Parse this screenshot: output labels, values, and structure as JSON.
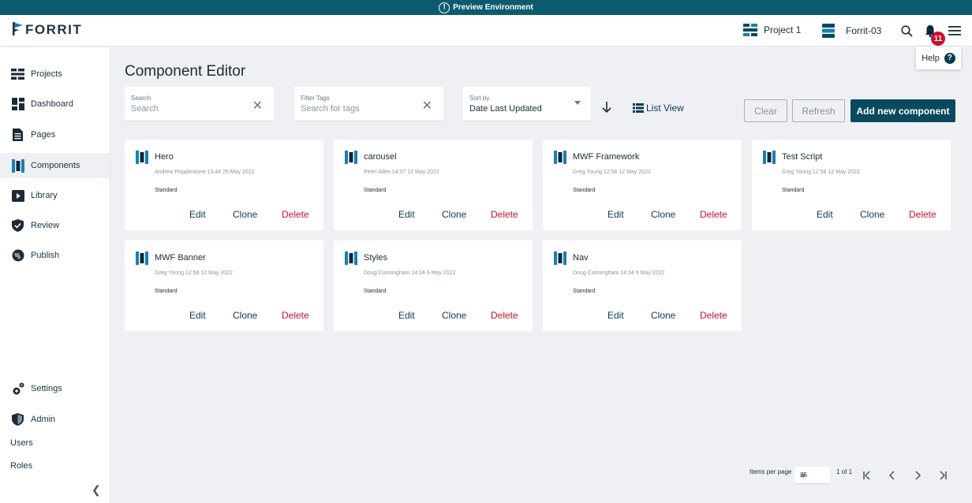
{
  "preview": {
    "label": "Preview Environment"
  },
  "brand": {
    "name": "FORRIT"
  },
  "topbar": {
    "project": "Project 1",
    "environment": "Forrit-03",
    "notifications_count": "11",
    "help_label": "Help"
  },
  "sidebar": {
    "items": [
      {
        "label": "Projects",
        "icon": "projects-icon"
      },
      {
        "label": "Dashboard",
        "icon": "dashboard-icon"
      },
      {
        "label": "Pages",
        "icon": "pages-icon"
      },
      {
        "label": "Components",
        "icon": "components-icon",
        "active": true
      },
      {
        "label": "Library",
        "icon": "library-icon"
      },
      {
        "label": "Review",
        "icon": "review-icon"
      },
      {
        "label": "Publish",
        "icon": "publish-icon"
      }
    ],
    "bottom": [
      {
        "label": "Settings",
        "icon": "gear-icon"
      },
      {
        "label": "Admin",
        "icon": "admin-shield-icon"
      }
    ],
    "sub_links": [
      "Users",
      "Roles"
    ]
  },
  "main": {
    "title": "Component Editor",
    "search": {
      "label": "Search",
      "placeholder": "Search"
    },
    "filter": {
      "label": "Filter Tags",
      "placeholder": "Search for tags"
    },
    "sort": {
      "label": "Sort by",
      "value": "Date Last Updated"
    },
    "list_view_label": "List View",
    "buttons": {
      "clear": "Clear",
      "refresh": "Refresh",
      "add": "Add new component"
    }
  },
  "card_actions": {
    "edit": "Edit",
    "clone": "Clone",
    "delete": "Delete"
  },
  "components": [
    {
      "name": "Hero",
      "meta": "Andrew Popplestone 13:44 25 May 2022",
      "type": "Standard"
    },
    {
      "name": "carousel",
      "meta": "Peter Allen 14:07 12 May 2022",
      "type": "Standard"
    },
    {
      "name": "MWF Framework",
      "meta": "Greg Young 12:58 12 May 2022",
      "type": "Standard"
    },
    {
      "name": "Test Script",
      "meta": "Greg Young 12:58 12 May 2022",
      "type": "Standard"
    },
    {
      "name": "MWF Banner",
      "meta": "Greg Young 12:58 12 May 2022",
      "type": "Standard"
    },
    {
      "name": "Styles",
      "meta": "Doug Cunningham 14:34 9 May 2022",
      "type": "Standard"
    },
    {
      "name": "Nav",
      "meta": "Doug Cunningham 14:34 9 May 2022",
      "type": "Standard"
    }
  ],
  "pagination": {
    "items_per_page_label": "Items per page",
    "items_per_page": "25",
    "range": "1 of 1"
  },
  "colors": {
    "brand": "#0b4a5e",
    "preview_bar": "#0c5a6e",
    "delete": "#c8102e",
    "badge": "#c8102e",
    "icon_accent": "#1a7fb0"
  }
}
